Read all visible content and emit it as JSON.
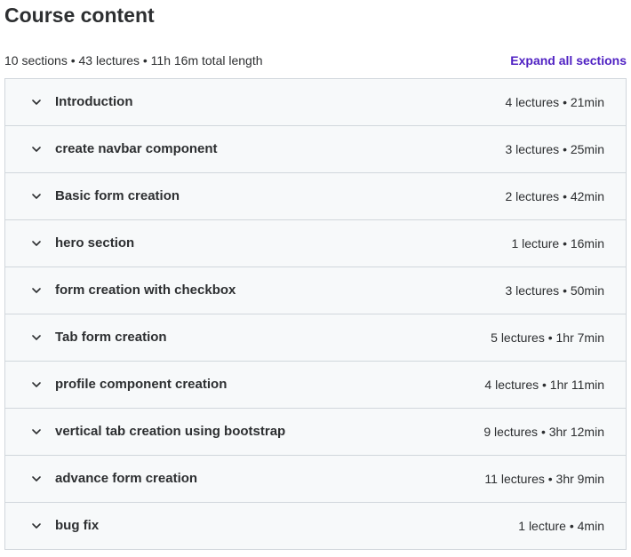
{
  "header": {
    "title": "Course content",
    "summary": "10 sections • 43 lectures • 11h 16m total length",
    "expand_all_label": "Expand all sections"
  },
  "sections": [
    {
      "title": "Introduction",
      "meta": "4 lectures • 21min"
    },
    {
      "title": "create navbar component",
      "meta": "3 lectures • 25min"
    },
    {
      "title": "Basic form creation",
      "meta": "2 lectures • 42min"
    },
    {
      "title": "hero section",
      "meta": "1 lecture • 16min"
    },
    {
      "title": "form creation with checkbox",
      "meta": "3 lectures • 50min"
    },
    {
      "title": "Tab form creation",
      "meta": "5 lectures • 1hr 7min"
    },
    {
      "title": "profile component creation",
      "meta": "4 lectures • 1hr 11min"
    },
    {
      "title": "vertical tab creation using bootstrap",
      "meta": "9 lectures • 3hr 12min"
    },
    {
      "title": "advance form creation",
      "meta": "11 lectures • 3hr 9min"
    },
    {
      "title": "bug fix",
      "meta": "1 lecture • 4min"
    }
  ],
  "icons": {
    "section_toggle": "chevron-down-icon"
  },
  "colors": {
    "text": "#2d2f31",
    "accent": "#5022c3",
    "section_bg": "#f7f9fa",
    "border": "#d1d7dc"
  }
}
